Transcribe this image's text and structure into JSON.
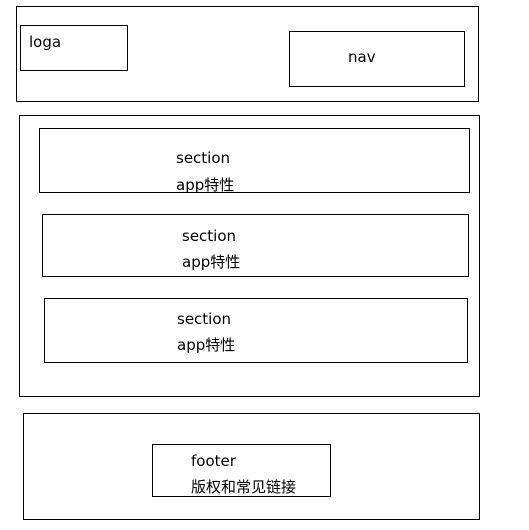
{
  "header": {
    "logo_label": "loga",
    "nav_label": "nav"
  },
  "main": {
    "sections": [
      {
        "title": "section",
        "subtitle": "app特性"
      },
      {
        "title": "section",
        "subtitle": "app特性"
      },
      {
        "title": "section",
        "subtitle": "app特性"
      }
    ]
  },
  "footer": {
    "title": "footer",
    "subtitle": "版权和常见链接"
  }
}
